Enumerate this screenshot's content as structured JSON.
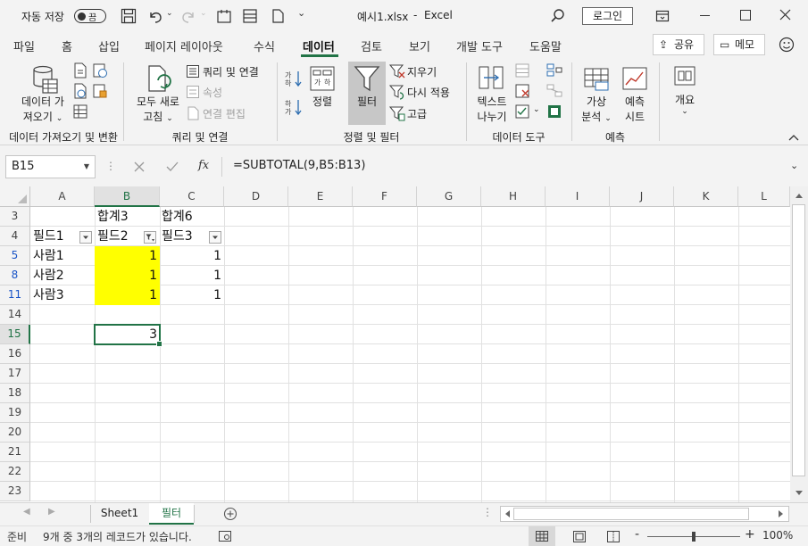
{
  "titlebar": {
    "autosave_label": "자동 저장",
    "autosave_state": "끔",
    "filename": "예시1.xlsx",
    "separator": "-",
    "app": "Excel",
    "login": "로그인"
  },
  "tabs": [
    "파일",
    "홈",
    "삽입",
    "페이지 레이아웃",
    "수식",
    "데이터",
    "검토",
    "보기",
    "개발 도구",
    "도움말"
  ],
  "active_tab": "데이터",
  "share": {
    "share_label": "공유",
    "comment_label": "메모"
  },
  "ribbon": {
    "get_data_line1": "데이터 가",
    "get_data_line2": "져오기",
    "refresh_line1": "모두 새로",
    "refresh_line2": "고침",
    "queries": "쿼리 및 연결",
    "properties": "속성",
    "edit_links": "연결 편집",
    "sort": "정렬",
    "filter": "필터",
    "clear": "지우기",
    "reapply": "다시 적용",
    "advanced": "고급",
    "text_to_cols_line1": "텍스트",
    "text_to_cols_line2": "나누기",
    "whatif_line1": "가상",
    "whatif_line2": "분석",
    "forecast_line1": "예측",
    "forecast_line2": "시트",
    "outline": "개요",
    "groups": {
      "get_transform": "데이터 가져오기 및 변환",
      "queries": "쿼리 및 연결",
      "sort_filter": "정렬 및 필터",
      "data_tools": "데이터 도구",
      "forecast": "예측"
    }
  },
  "formula_bar": {
    "name_box": "B15",
    "fx": "fx",
    "formula": "=SUBTOTAL(9,B5:B13)"
  },
  "grid": {
    "columns": [
      "A",
      "B",
      "C",
      "D",
      "E",
      "F",
      "G",
      "H",
      "I",
      "J",
      "K",
      "L"
    ],
    "selected_column": "B",
    "rows": [
      "3",
      "4",
      "5",
      "8",
      "11",
      "14",
      "15",
      "16",
      "17",
      "18",
      "19",
      "20",
      "21",
      "22",
      "23"
    ],
    "filtered_rows": [
      "5",
      "8",
      "11"
    ],
    "selected_row": "15",
    "cells": {
      "B3": "합계3",
      "C3": "합계6",
      "A4": "필드1",
      "B4": "필드2",
      "C4": "필드3",
      "A5": "사람1",
      "B5": "1",
      "C5": "1",
      "A8": "사람2",
      "B8": "1",
      "C8": "1",
      "A11": "사람3",
      "B11": "1",
      "C11": "1",
      "B15": "3"
    },
    "highlight_color": "#FFFF00"
  },
  "sheets": [
    "Sheet1",
    "필터"
  ],
  "active_sheet": "필터",
  "statusbar": {
    "ready": "준비",
    "record_count": "9개 중 3개의 레코드가 있습니다.",
    "zoom": "100%",
    "zoom_minus": "-",
    "zoom_plus": "+"
  },
  "colors": {
    "accent": "#217346",
    "filter_highlight": "#FFFF00"
  }
}
